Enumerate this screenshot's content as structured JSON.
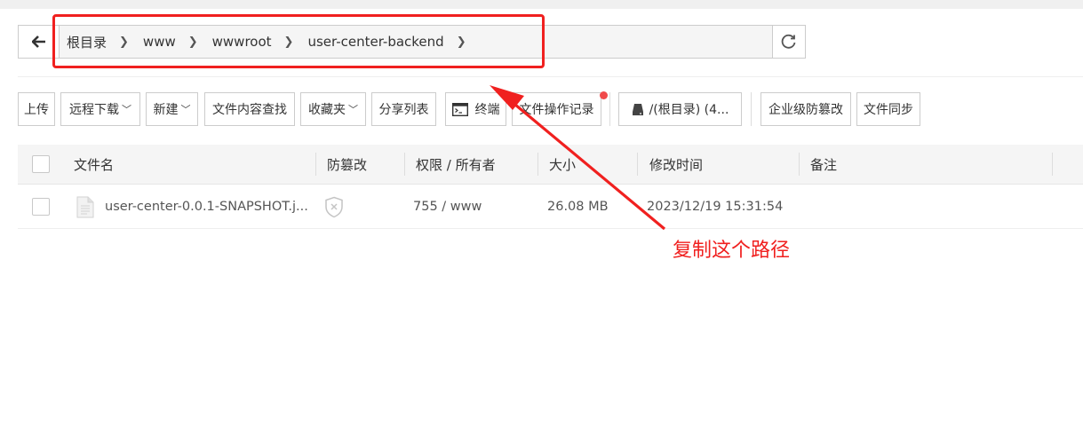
{
  "breadcrumb": {
    "items": [
      "根目录",
      "www",
      "wwwroot",
      "user-center-backend"
    ]
  },
  "toolbar": {
    "upload": "上传",
    "remote_download": "远程下载",
    "new": "新建",
    "content_search": "文件内容查找",
    "favorites": "收藏夹",
    "share_list": "分享列表",
    "terminal": "终端",
    "operation_log": "文件操作记录",
    "disk": "/(根目录) (4...",
    "tamper_proof": "企业级防篡改",
    "file_sync": "文件同步"
  },
  "table": {
    "headers": {
      "name": "文件名",
      "tamper": "防篡改",
      "perm": "权限 / 所有者",
      "size": "大小",
      "modified": "修改时间",
      "note": "备注"
    },
    "rows": [
      {
        "name": "user-center-0.0.1-SNAPSHOT.j...",
        "perm": "755 / www",
        "size": "26.08 MB",
        "modified": "2023/12/19 15:31:54",
        "note": ""
      }
    ]
  },
  "annotation": {
    "text": "复制这个路径",
    "color": "#f0201f"
  },
  "icons": {
    "back": "arrow-left-icon",
    "refresh": "refresh-icon",
    "terminal": "terminal-icon",
    "disk": "disk-icon",
    "file": "file-icon",
    "tamper": "shield-x-icon",
    "chevron": "chevron-right-icon",
    "dropdown": "chevron-down-icon"
  }
}
